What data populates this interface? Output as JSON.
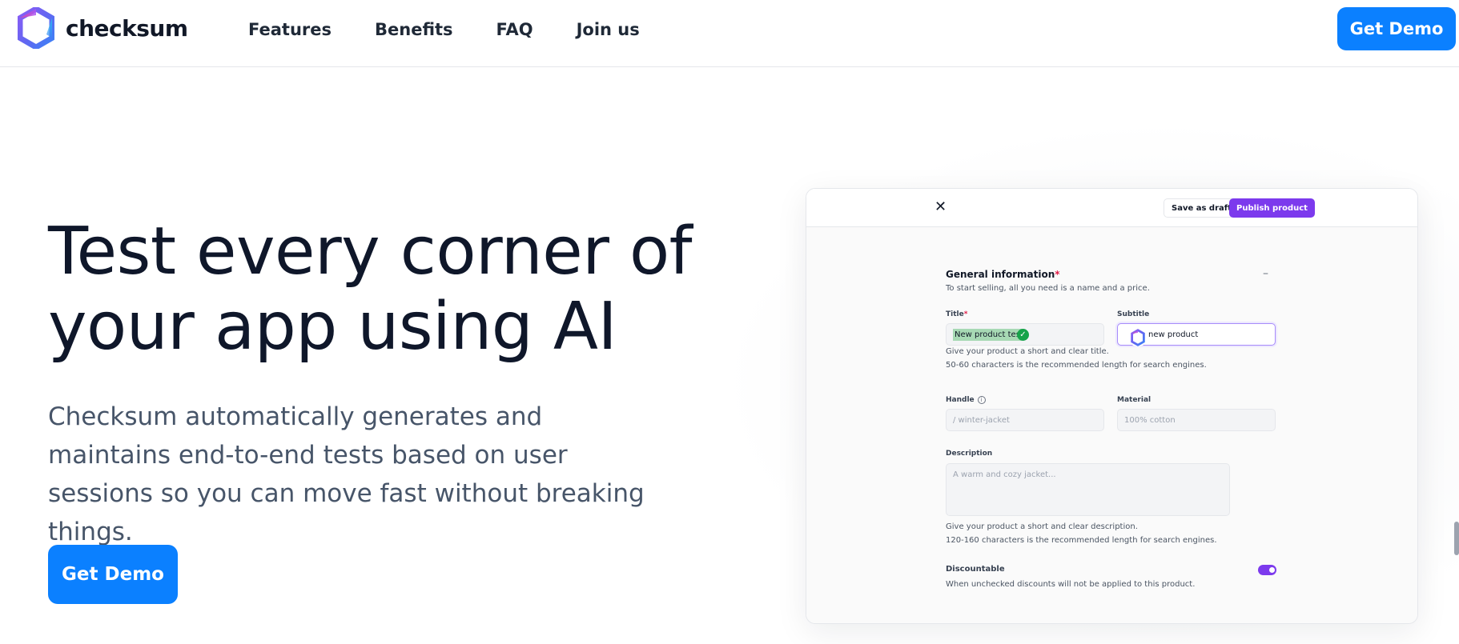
{
  "brand": {
    "name": "checksum"
  },
  "nav": {
    "items": [
      {
        "label": "Features"
      },
      {
        "label": "Benefits"
      },
      {
        "label": "FAQ"
      },
      {
        "label": "Join us"
      }
    ],
    "cta_label": "Get Demo"
  },
  "hero": {
    "title_line1": "Test every corner of",
    "title_line2": "your app using AI",
    "subtitle": "Checksum automatically generates and maintains end-to-end tests based on user sessions so you can move fast without breaking things.",
    "cta_label": "Get Demo"
  },
  "mock": {
    "close_symbol": "✕",
    "save_draft_label": "Save as draft",
    "publish_label": "Publish product",
    "section_title": "General information",
    "required_mark": "*",
    "collapse_symbol": "–",
    "section_desc": "To start selling, all you need is a name and a price.",
    "title_label": "Title",
    "title_value": "New product tes",
    "subtitle_label": "Subtitle",
    "subtitle_value": "new product",
    "title_hint_line1": "Give your product a short and clear title.",
    "title_hint_line2": "50-60 characters is the recommended length for search engines.",
    "handle_label": "Handle",
    "handle_placeholder": "/ winter-jacket",
    "material_label": "Material",
    "material_placeholder": "100% cotton",
    "description_label": "Description",
    "description_placeholder": "A warm and cozy jacket...",
    "desc_hint_line1": "Give your product a short and clear description.",
    "desc_hint_line2": "120-160 characters is the recommended length for search engines.",
    "discountable_label": "Discountable",
    "discountable_desc": "When unchecked discounts will not be applied to this product.",
    "discountable_on": true
  },
  "colors": {
    "primary": "#0b80ff",
    "heading": "#0f172a",
    "body_text": "#475569",
    "accent_purple": "#7c3aed",
    "highlight_green": "#a7d9b4"
  },
  "icons": {
    "logo": "checksum-hexagon-logo-icon",
    "check": "check-circle-icon",
    "info": "info-icon",
    "close": "close-icon"
  }
}
